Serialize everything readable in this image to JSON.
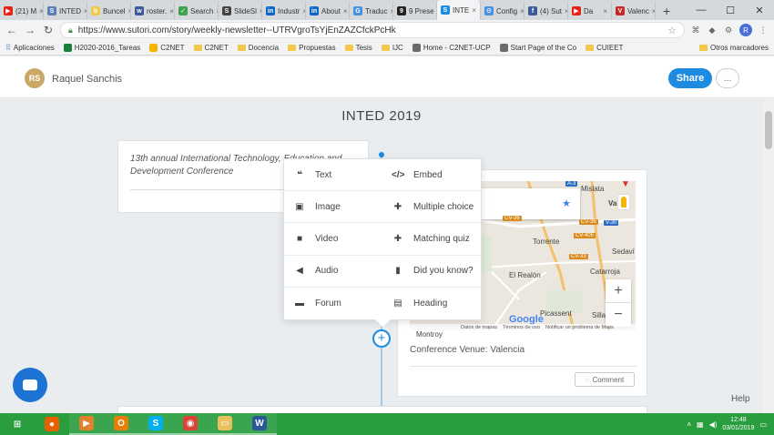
{
  "browser": {
    "tabs": [
      {
        "label": "(21) M",
        "fav": "#e62117",
        "glyph": "▶"
      },
      {
        "label": "INTED",
        "fav": "#5a7fb5",
        "glyph": "S"
      },
      {
        "label": "Buncel",
        "fav": "#f2c94c",
        "glyph": "b"
      },
      {
        "label": "roster.",
        "fav": "#3b5998",
        "glyph": "w"
      },
      {
        "label": "Search",
        "fav": "#3fa34d",
        "glyph": "✓"
      },
      {
        "label": "SlideSl",
        "fav": "#444444",
        "glyph": "S"
      },
      {
        "label": "Industr",
        "fav": "#0a66c2",
        "glyph": "in"
      },
      {
        "label": "About",
        "fav": "#0a66c2",
        "glyph": "in"
      },
      {
        "label": "Traduc",
        "fav": "#4a90e2",
        "glyph": "G"
      },
      {
        "label": "9 Prese",
        "fav": "#222222",
        "glyph": "9"
      },
      {
        "label": "INTE",
        "fav": "#1d8ce0",
        "glyph": "S",
        "active": true
      },
      {
        "label": "Config",
        "fav": "#4a90e2",
        "glyph": "⚙"
      },
      {
        "label": "(4) Sut",
        "fav": "#3b5998",
        "glyph": "f"
      },
      {
        "label": "Da",
        "fav": "#e62117",
        "glyph": "▶"
      },
      {
        "label": "Valenc",
        "fav": "#c62828",
        "glyph": "V"
      }
    ],
    "new_tab": "+",
    "window_controls": [
      "—",
      "☐",
      "✕"
    ],
    "url": "https://www.sutori.com/story/weekly-newsletter--UTRVgroTsYjEnZAZCfckPcHk",
    "profile_initial": "R",
    "bookmarks": [
      {
        "label": "Aplicaciones",
        "type": "apps"
      },
      {
        "label": "H2020-2016_Tareas",
        "type": "sheet"
      },
      {
        "label": "C2NET",
        "type": "drive"
      },
      {
        "label": "C2NET",
        "type": "folder"
      },
      {
        "label": "Docencia",
        "type": "folder"
      },
      {
        "label": "Propuestas",
        "type": "folder"
      },
      {
        "label": "Tesis",
        "type": "folder"
      },
      {
        "label": "IJC",
        "type": "folder"
      },
      {
        "label": "Home - C2NET-UCP",
        "type": "page"
      },
      {
        "label": "Start Page of the Co",
        "type": "page"
      },
      {
        "label": "CUIEET",
        "type": "folder"
      }
    ],
    "other_bookmarks": "Otros marcadores"
  },
  "header": {
    "avatar_initials": "RS",
    "author": "Raquel Sanchis",
    "share_label": "Share",
    "more_label": "..."
  },
  "story": {
    "title": "INTED 2019",
    "left_card_text": "13th annual International Technology, Education and Development Conference",
    "venue": "Conference Venue: Valencia",
    "comment_label": "Comment",
    "help_label": "Help"
  },
  "map": {
    "places": {
      "mislata": "Mislata",
      "valencia": "Vale",
      "torrente": "Torrente",
      "sedavi": "Sedaví",
      "catarroja": "Catarroja",
      "el_realon": "El Realón",
      "picassent": "Picassent",
      "silla": "Silla",
      "montroy": "Montroy"
    },
    "roads": {
      "a3": "A-3",
      "v30": "V-30",
      "cv36a": "CV-36",
      "cv36b": "CV-36",
      "cv33": "CV-33",
      "cv405": "CV-405"
    },
    "google": "Google",
    "footer": [
      "Datos de mapas",
      "Términos de uso",
      "Notificar un problema de Maps"
    ],
    "zoom_in": "+",
    "zoom_out": "−"
  },
  "add_menu": {
    "items": [
      {
        "label": "Text",
        "icon": "quote-icon",
        "glyph": "❝"
      },
      {
        "label": "Embed",
        "icon": "code-icon",
        "glyph": "</>"
      },
      {
        "label": "Image",
        "icon": "image-icon",
        "glyph": "▣"
      },
      {
        "label": "Multiple choice",
        "icon": "puzzle-icon",
        "glyph": "✚"
      },
      {
        "label": "Video",
        "icon": "video-icon",
        "glyph": "■"
      },
      {
        "label": "Matching quiz",
        "icon": "puzzle-icon",
        "glyph": "✚"
      },
      {
        "label": "Audio",
        "icon": "speaker-icon",
        "glyph": "◀"
      },
      {
        "label": "Did you know?",
        "icon": "bookmark-icon",
        "glyph": "▮"
      },
      {
        "label": "Forum",
        "icon": "forum-icon",
        "glyph": "▬"
      },
      {
        "label": "Heading",
        "icon": "heading-icon",
        "glyph": "▤"
      }
    ],
    "add_button": "+"
  },
  "taskbar": {
    "apps": [
      {
        "name": "start",
        "color": "#2a9d3f",
        "glyph": "⊞"
      },
      {
        "name": "firefox",
        "color": "#e66000",
        "glyph": "●"
      },
      {
        "name": "media",
        "color": "#e0822c",
        "glyph": "▶"
      },
      {
        "name": "outlook",
        "color": "#e87e04",
        "glyph": "O"
      },
      {
        "name": "skype",
        "color": "#00aff0",
        "glyph": "S"
      },
      {
        "name": "chrome",
        "color": "#db4437",
        "glyph": "◉"
      },
      {
        "name": "explorer",
        "color": "#e8c15a",
        "glyph": "▭"
      },
      {
        "name": "word",
        "color": "#2b579a",
        "glyph": "W"
      }
    ],
    "time": "12:48",
    "date": "03/01/2019"
  },
  "colors": {
    "accent": "#1d8ce0",
    "taskbar": "#2a9d3f",
    "avatar": "#c9a865"
  }
}
